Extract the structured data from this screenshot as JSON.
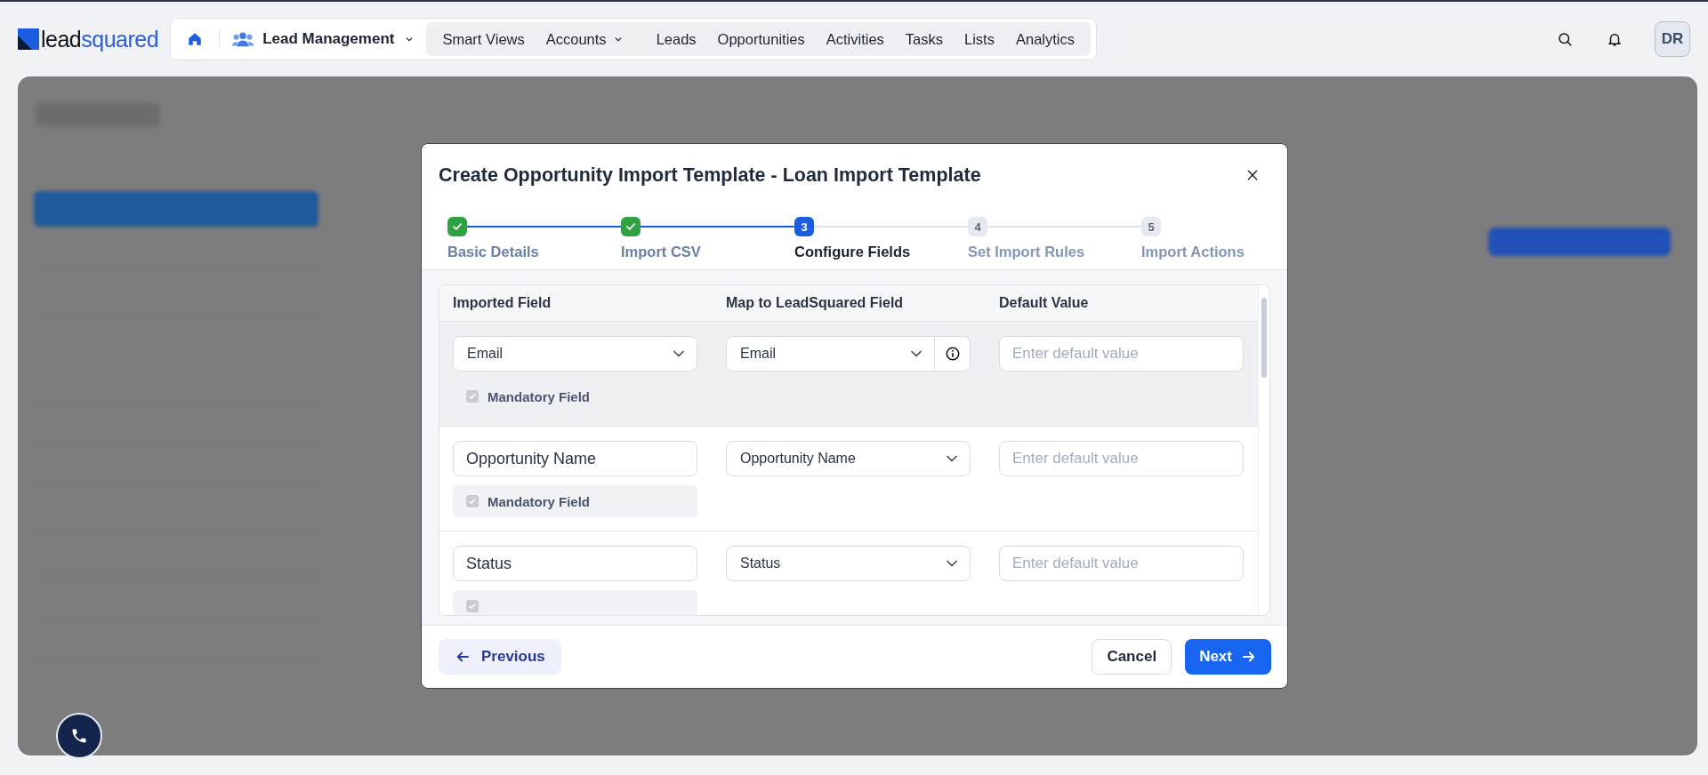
{
  "top_nav": {
    "logo": {
      "part_1": "lead",
      "part_2": "squared"
    },
    "module": {
      "label": "Lead Management",
      "dropdown": true
    },
    "items": [
      {
        "label": "Smart Views",
        "dropdown": false
      },
      {
        "label": "Accounts",
        "dropdown": true
      },
      {
        "label": "Leads",
        "dropdown": false
      },
      {
        "label": "Opportunities",
        "dropdown": false
      },
      {
        "label": "Activities",
        "dropdown": false
      },
      {
        "label": "Tasks",
        "dropdown": false
      },
      {
        "label": "Lists",
        "dropdown": false
      },
      {
        "label": "Analytics",
        "dropdown": false
      }
    ],
    "avatar": "DR"
  },
  "dialog": {
    "title": "Create Opportunity Import Template - Loan Import Template",
    "steps": [
      {
        "label": "Basic Details",
        "kind": "done"
      },
      {
        "label": "Import CSV",
        "kind": "done"
      },
      {
        "number": "3",
        "label": "Configure Fields",
        "kind": "current"
      },
      {
        "number": "4",
        "label": "Set Import Rules",
        "kind": "upcoming"
      },
      {
        "number": "5",
        "label": "Import Actions",
        "kind": "upcoming"
      }
    ],
    "table": {
      "columns": [
        "Imported Field",
        "Map to LeadSquared Field",
        "Default Value"
      ],
      "rows": [
        {
          "imported": {
            "kind": "select",
            "value": "Email"
          },
          "mapped": "Email",
          "info": true,
          "default_placeholder": "Enter default value",
          "mandatory": {
            "checked": true,
            "label": "Mandatory Field"
          },
          "highlighted": true
        },
        {
          "imported": {
            "kind": "input",
            "value": "Opportunity Name"
          },
          "mapped": "Opportunity Name",
          "info": false,
          "default_placeholder": "Enter default value",
          "mandatory": {
            "checked": true,
            "label": "Mandatory Field"
          },
          "highlighted": false
        },
        {
          "imported": {
            "kind": "input",
            "value": "Status"
          },
          "mapped": "Status",
          "info": false,
          "default_placeholder": "Enter default value",
          "mandatory": {
            "checked": true
          },
          "highlighted": false
        }
      ]
    },
    "buttons": {
      "previous": "Previous",
      "cancel": "Cancel",
      "next": "Next"
    }
  }
}
